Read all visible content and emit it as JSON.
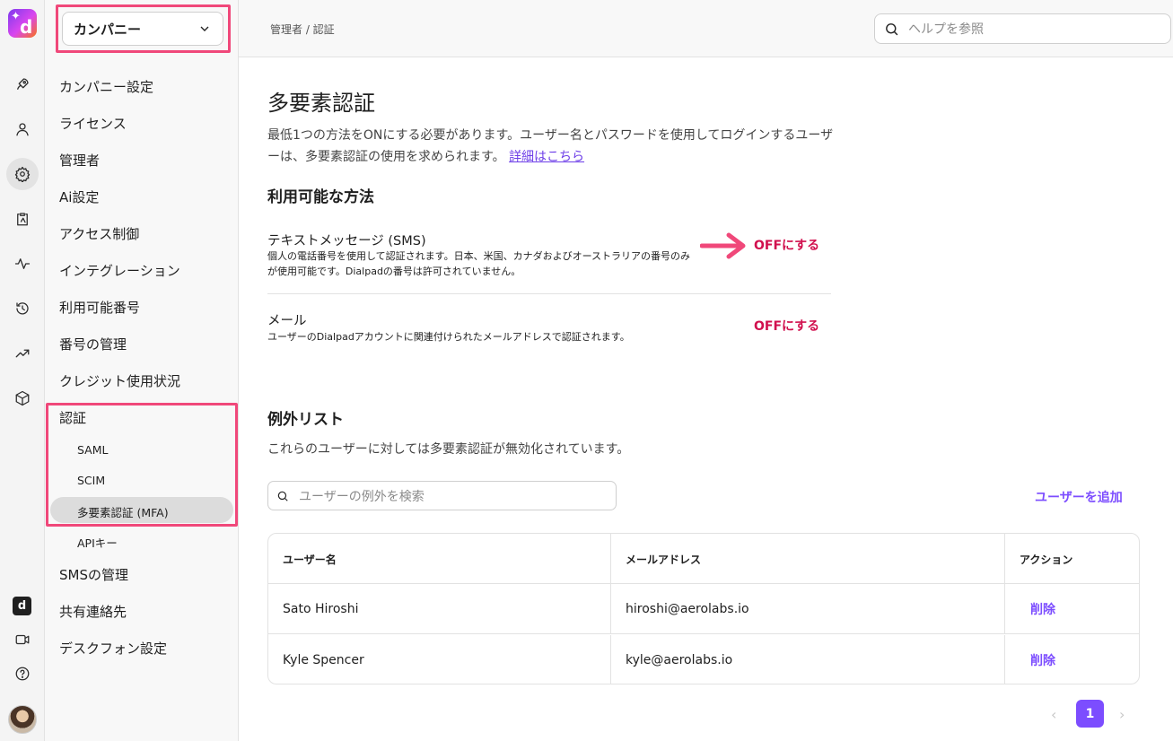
{
  "rail": {
    "logo_letter": "d",
    "icons": [
      "rocket-icon",
      "person-icon",
      "gear-icon",
      "clipboard-icon",
      "activity-icon",
      "history-icon",
      "trending-icon",
      "cube-icon",
      "dialpad-logo-icon",
      "video-icon",
      "help-icon"
    ],
    "app_letter": "d"
  },
  "sidebar": {
    "company_select": "カンパニー",
    "items": [
      {
        "label": "カンパニー設定"
      },
      {
        "label": "ライセンス"
      },
      {
        "label": "管理者"
      },
      {
        "label": "Ai設定"
      },
      {
        "label": "アクセス制御"
      },
      {
        "label": "インテグレーション"
      },
      {
        "label": "利用可能番号"
      },
      {
        "label": "番号の管理"
      },
      {
        "label": "クレジット使用状況"
      },
      {
        "label": "認証"
      }
    ],
    "sub_items": [
      {
        "label": "SAML"
      },
      {
        "label": "SCIM"
      },
      {
        "label": "多要素認証 (MFA)"
      },
      {
        "label": "APIキー"
      }
    ],
    "items_after": [
      {
        "label": "SMSの管理"
      },
      {
        "label": "共有連絡先"
      },
      {
        "label": "デスクフォン設定"
      }
    ]
  },
  "header": {
    "breadcrumb": "管理者 / 認証",
    "search_placeholder": "ヘルプを参照"
  },
  "main": {
    "title": "多要素認証",
    "description": "最低1つの方法をONにする必要があります。ユーザー名とパスワードを使用してログインするユーザーは、多要素認証の使用を求められます。",
    "details_link": "詳細はこちら",
    "methods_heading": "利用可能な方法",
    "methods": [
      {
        "name": "テキストメッセージ (SMS)",
        "description": "個人の電話番号を使用して認証されます。日本、米国、カナダおよびオーストラリアの番号のみが使用可能です。Dialpadの番号は許可されていません。",
        "action": "OFFにする"
      },
      {
        "name": "メール",
        "description": "ユーザーのDialpadアカウントに関連付けられたメールアドレスで認証されます。",
        "action": "OFFにする"
      }
    ],
    "exceptions_heading": "例外リスト",
    "exceptions_description": "これらのユーザーに対しては多要素認証が無効化されています。",
    "exceptions_search_placeholder": "ユーザーの例外を検索",
    "add_user": "ユーザーを追加",
    "table": {
      "headers": [
        "ユーザー名",
        "メールアドレス",
        "アクション"
      ],
      "rows": [
        {
          "name": "Sato Hiroshi",
          "email": "hiroshi@aerolabs.io",
          "action": "削除"
        },
        {
          "name": "Kyle Spencer",
          "email": "kyle@aerolabs.io",
          "action": "削除"
        }
      ]
    },
    "pagination": {
      "prev": "‹",
      "current": "1",
      "next": "›"
    }
  },
  "colors": {
    "accent": "#7c4dff",
    "danger": "#d1104e",
    "highlight": "#f0487a"
  }
}
